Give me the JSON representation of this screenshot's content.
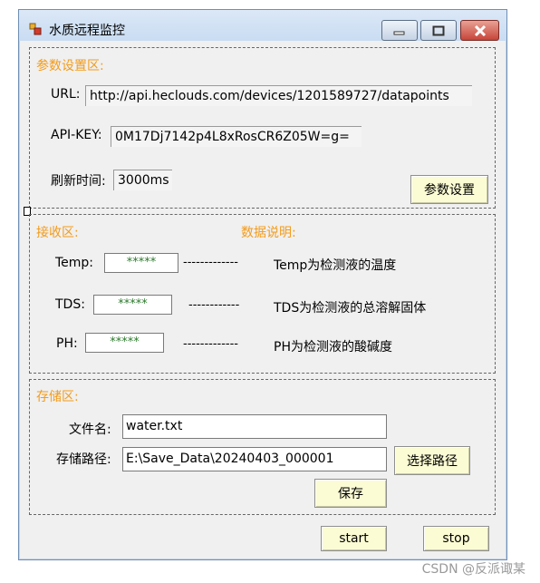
{
  "window": {
    "title": "水质远程监控"
  },
  "params": {
    "group_label": "参数设置区:",
    "url_label": "URL:",
    "url_value": "http://api.heclouds.com/devices/1201589727/datapoints",
    "apikey_label": "API-KEY:",
    "apikey_value": "0M17Dj7142p4L8xRosCR6Z05W=g=",
    "refresh_label": "刷新时间:",
    "refresh_value": "3000ms",
    "set_button": "参数设置"
  },
  "receive": {
    "group_label": "接收区:",
    "desc_label": "数据说明:",
    "rows": [
      {
        "label": "Temp:",
        "value": "*****",
        "dashes": "-------------",
        "desc": "Temp为检测液的温度"
      },
      {
        "label": "TDS:",
        "value": "*****",
        "dashes": "------------",
        "desc": "TDS为检测液的总溶解固体"
      },
      {
        "label": "PH:",
        "value": "*****",
        "dashes": "-------------",
        "desc": "PH为检测液的酸碱度"
      }
    ]
  },
  "storage": {
    "group_label": "存储区:",
    "filename_label": "文件名:",
    "filename_value": "water.txt",
    "path_label": "存储路径:",
    "path_value": "E:\\Save_Data\\20240403_000001",
    "choose_button": "选择路径",
    "save_button": "保存"
  },
  "controls": {
    "start": "start",
    "stop": "stop"
  },
  "watermark": "CSDN @反派诹某",
  "colors": {
    "group_label": "#f39b1a",
    "button_bg": "#fbfbd4",
    "close_red": "#c7453a",
    "masked_value": "#2a7a2a"
  }
}
